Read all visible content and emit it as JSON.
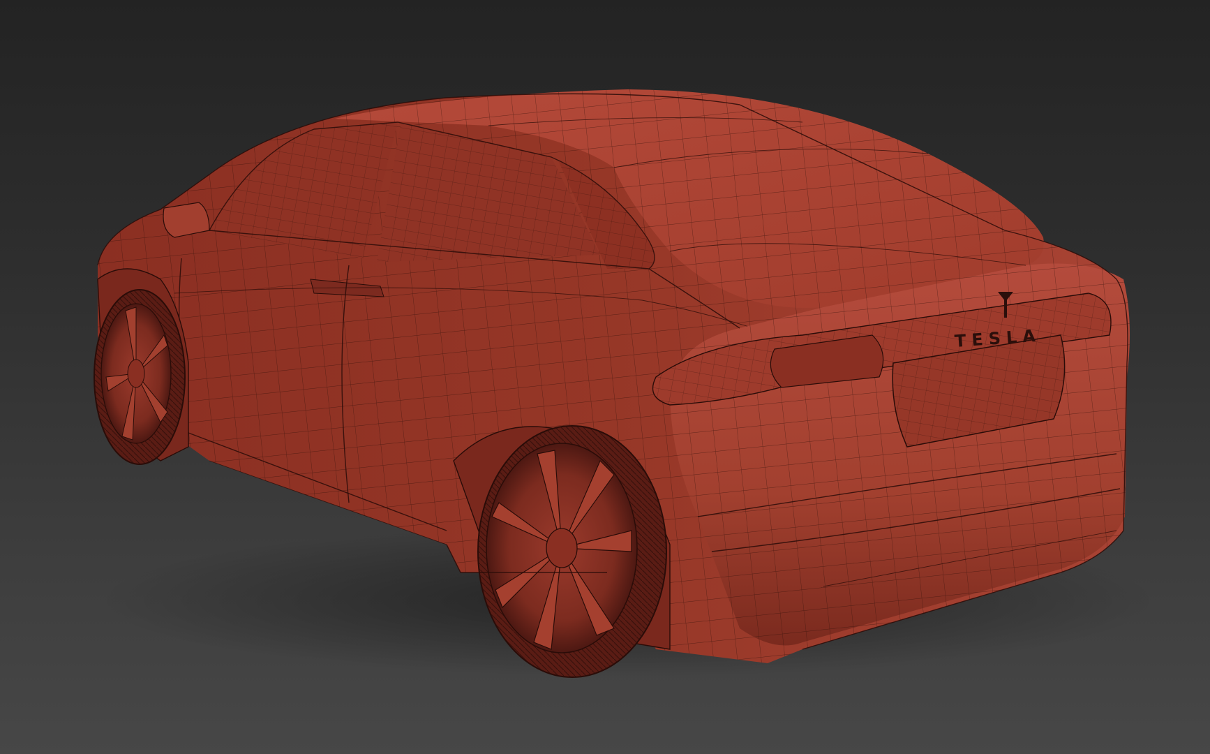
{
  "viewport": {
    "background_top": "#232323",
    "background_bottom": "#474747"
  },
  "model": {
    "subject": "car-wireframe-model",
    "shading_color": "#b0473a",
    "shading_dark": "#7e2a20",
    "wire_color": "#2a0c08",
    "badge_text": "TESLA"
  }
}
